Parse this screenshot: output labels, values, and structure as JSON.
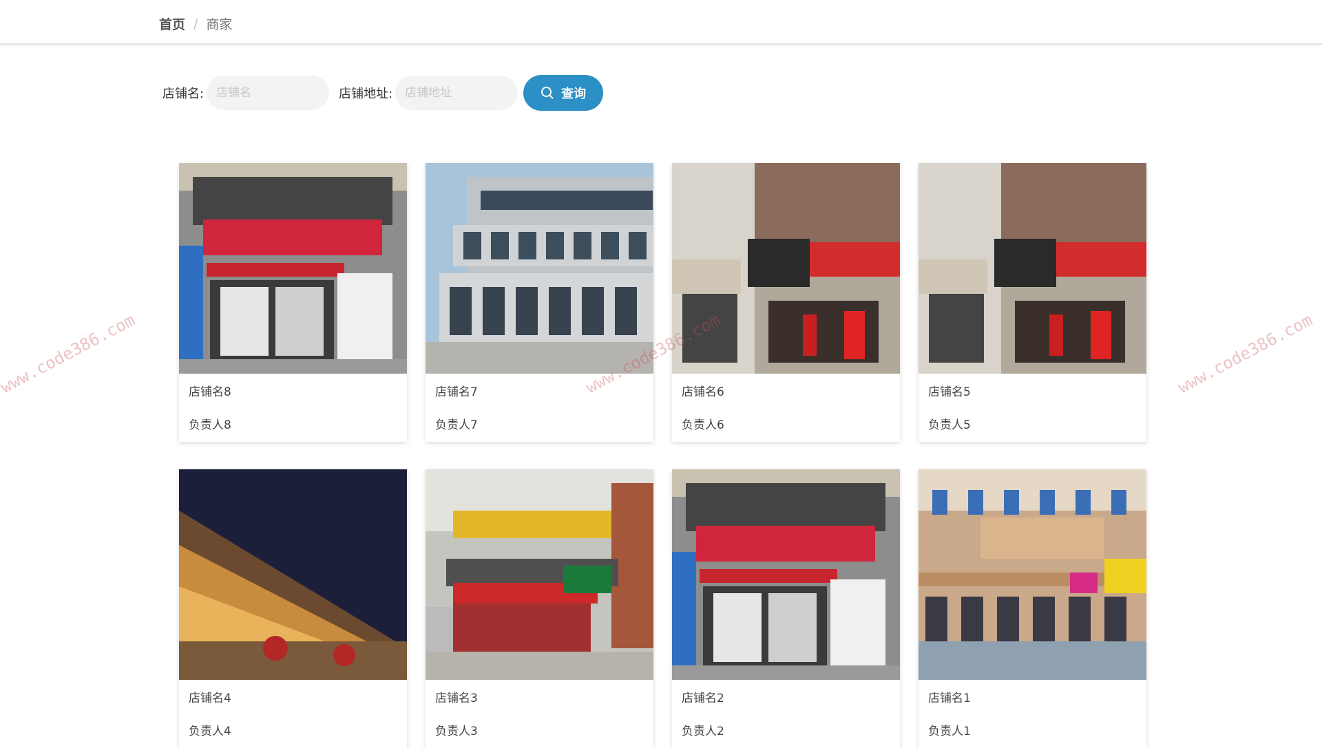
{
  "breadcrumb": {
    "home": "首页",
    "separator": "/",
    "current": "商家"
  },
  "search": {
    "name_label": "店铺名:",
    "name_placeholder": "店铺名",
    "name_value": "",
    "address_label": "店铺地址:",
    "address_placeholder": "店铺地址",
    "address_value": "",
    "button_label": "查询",
    "button_icon": "search-icon",
    "button_color": "#2c8fc6"
  },
  "shops": [
    {
      "name": "店铺名8",
      "owner": "负责人8",
      "scene": "convenience-store"
    },
    {
      "name": "店铺名7",
      "owner": "负责人7",
      "scene": "office-building"
    },
    {
      "name": "店铺名6",
      "owner": "负责人6",
      "scene": "street-shops"
    },
    {
      "name": "店铺名5",
      "owner": "负责人5",
      "scene": "street-shops"
    },
    {
      "name": "店铺名4",
      "owner": "负责人4",
      "scene": "night-mall"
    },
    {
      "name": "店铺名3",
      "owner": "负责人3",
      "scene": "fruit-market"
    },
    {
      "name": "店铺名2",
      "owner": "负责人2",
      "scene": "convenience-store"
    },
    {
      "name": "店铺名1",
      "owner": "负责人1",
      "scene": "european-street"
    }
  ],
  "watermark": "www.code386.com"
}
